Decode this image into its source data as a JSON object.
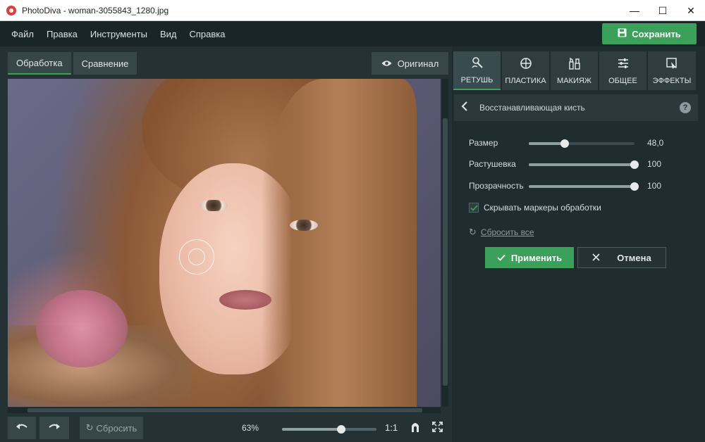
{
  "window": {
    "title": "PhotoDiva - woman-3055843_1280.jpg",
    "controls": [
      "—",
      "☐",
      "✕"
    ]
  },
  "menu": {
    "items": [
      "Файл",
      "Правка",
      "Инструменты",
      "Вид",
      "Справка"
    ]
  },
  "save_button": {
    "label": "Сохранить",
    "icon": "floppy-disk-icon"
  },
  "view_tabs": {
    "processing": "Обработка",
    "compare": "Сравнение"
  },
  "original_button": {
    "label": "Оригинал",
    "icon": "eye-icon"
  },
  "bottom": {
    "reset_label": "Сбросить",
    "zoom_percent": "63%",
    "zoom_level": 0.63,
    "one_to_one": "1:1"
  },
  "tool_tabs": [
    {
      "label": "РЕТУШЬ",
      "icon": "retouch-icon",
      "active": true
    },
    {
      "label": "ПЛАСТИКА",
      "icon": "plastic-icon",
      "active": false
    },
    {
      "label": "МАКИЯЖ",
      "icon": "makeup-icon",
      "active": false
    },
    {
      "label": "ОБЩЕЕ",
      "icon": "sliders-icon",
      "active": false
    },
    {
      "label": "ЭФФЕКТЫ",
      "icon": "effects-icon",
      "active": false
    }
  ],
  "tool_panel": {
    "title": "Восстанавливающая кисть",
    "help": "?",
    "sliders": [
      {
        "label": "Размер",
        "value": "48,0",
        "fraction": 0.34
      },
      {
        "label": "Растушевка",
        "value": "100",
        "fraction": 1.0
      },
      {
        "label": "Прозрачность",
        "value": "100",
        "fraction": 1.0
      }
    ],
    "hide_markers": {
      "label": "Скрывать маркеры обработки",
      "checked": true
    },
    "reset_all": "Сбросить все",
    "apply": "Применить",
    "cancel": "Отмена"
  },
  "colors": {
    "accent": "#3aa05a",
    "panel": "#1f2c30",
    "button": "#364649"
  }
}
